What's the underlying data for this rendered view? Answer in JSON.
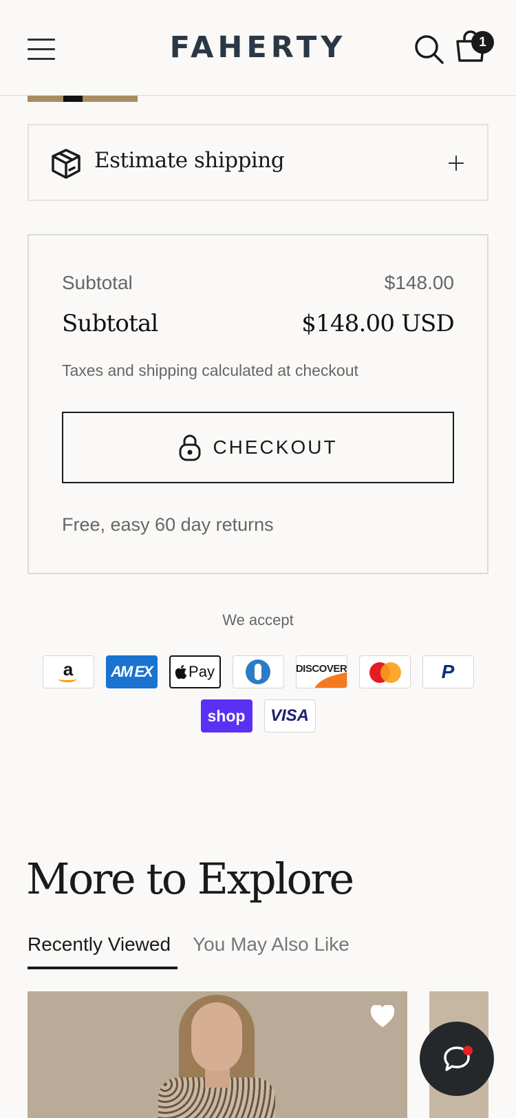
{
  "header": {
    "logo": "FAHERTY",
    "cart_count": "1"
  },
  "shipping": {
    "label": "Estimate shipping"
  },
  "summary": {
    "subtotal_label": "Subtotal",
    "subtotal_value": "$148.00",
    "total_label": "Subtotal",
    "total_value": "$148.00 USD",
    "taxes_note": "Taxes and shipping calculated at checkout",
    "checkout_label": "CHECKOUT",
    "returns_note": "Free, easy 60 day returns"
  },
  "payments": {
    "heading": "We accept",
    "amex": "AM EX",
    "applepay": "Pay",
    "discover": "DISCOVER",
    "paypal": "P",
    "shop": "shop",
    "visa": "VISA",
    "amazon": "a"
  },
  "explore": {
    "title": "More to Explore",
    "tabs": [
      {
        "label": "Recently Viewed",
        "active": true
      },
      {
        "label": "You May Also Like",
        "active": false
      }
    ]
  }
}
